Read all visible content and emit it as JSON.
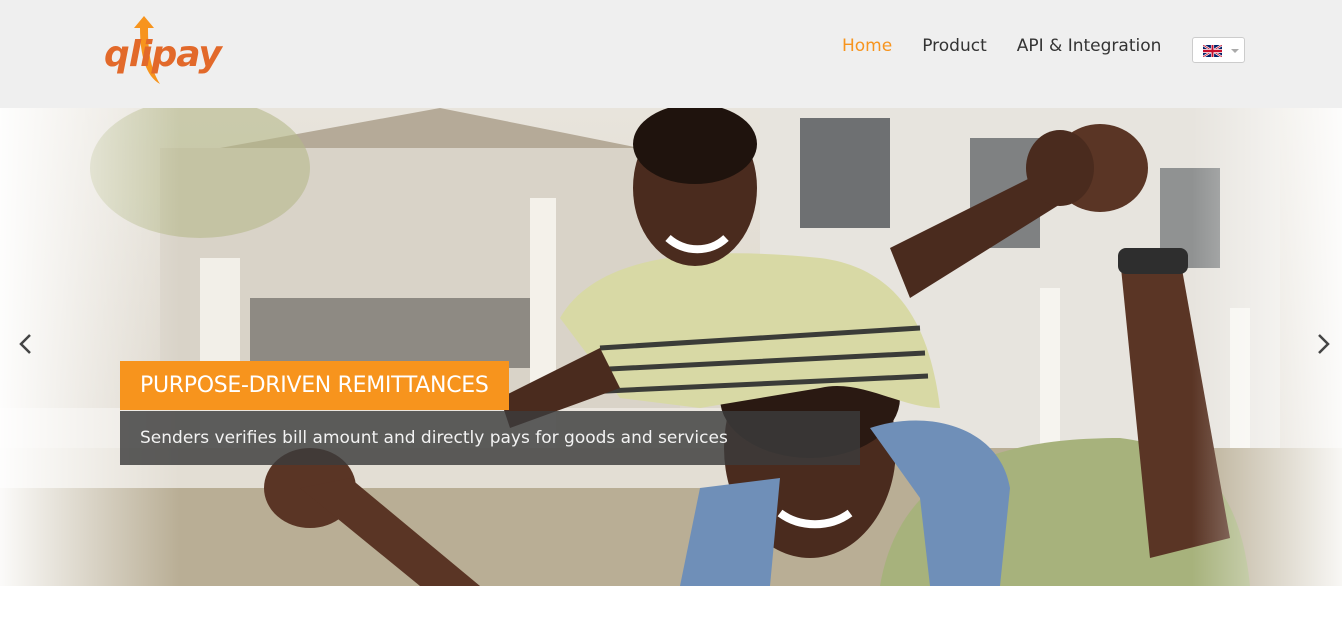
{
  "brand": {
    "logo_text": "qlipay",
    "logo_color": "#e2692a"
  },
  "nav": {
    "items": [
      {
        "label": "Home",
        "active": true
      },
      {
        "label": "Product",
        "active": false
      },
      {
        "label": "API & Integration",
        "active": false
      }
    ],
    "active_color": "#f7941d",
    "language": {
      "icon": "uk-flag-icon"
    }
  },
  "hero": {
    "title": "PURPOSE-DRIVEN REMITTANCES",
    "subtitle": "Senders verifies bill amount and directly pays for goods and services",
    "title_bg": "#f7941d",
    "prev_icon": "chevron-left-icon",
    "next_icon": "chevron-right-icon"
  }
}
